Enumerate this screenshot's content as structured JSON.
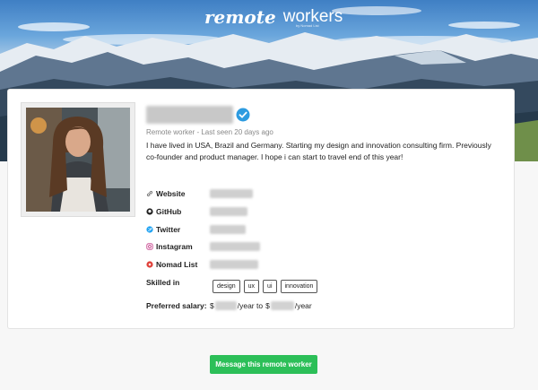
{
  "header": {
    "logo_part1": "remote",
    "logo_part2": "workers",
    "logo_tagline": "by Nomad List"
  },
  "profile": {
    "status": "Remote worker - Last seen 20 days ago",
    "bio": "I have lived in USA, Brazil and Germany. Starting my design and innovation consulting firm. Previously co-founder and product manager. I hope i can start to travel end of this year!",
    "verified": true,
    "verified_color": "#2d9be0"
  },
  "links": [
    {
      "label": "Website",
      "icon": "link-icon"
    },
    {
      "label": "GitHub",
      "icon": "github-icon"
    },
    {
      "label": "Twitter",
      "icon": "twitter-icon"
    },
    {
      "label": "Instagram",
      "icon": "instagram-icon"
    },
    {
      "label": "Nomad List",
      "icon": "nomadlist-icon"
    }
  ],
  "skills": {
    "label": "Skilled in",
    "items": [
      "design",
      "ux",
      "ui",
      "innovation"
    ]
  },
  "salary": {
    "label": "Preferred salary:",
    "currency": "$",
    "suffix1": "/year to",
    "suffix2": "/year"
  },
  "cta": {
    "label": "Message this remote worker",
    "color": "#2cbf58"
  }
}
